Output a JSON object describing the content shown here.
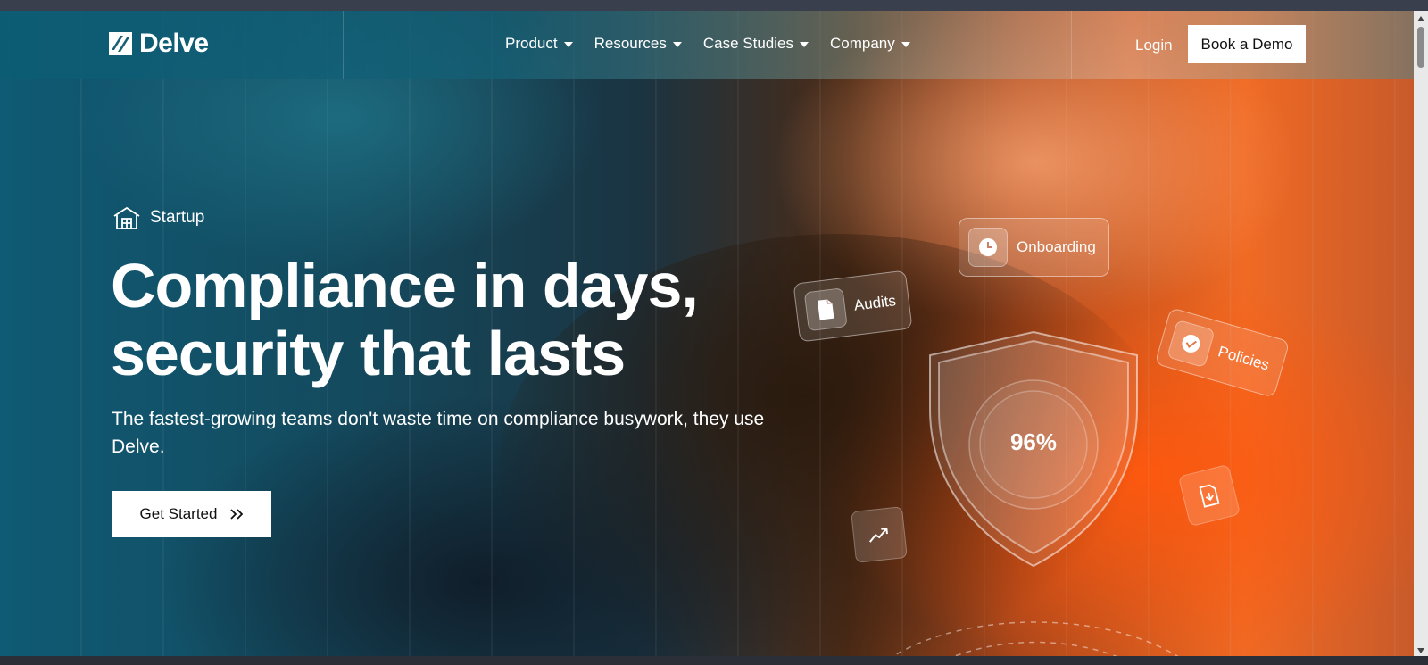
{
  "nav": {
    "brand": "Delve",
    "menu": [
      {
        "label": "Product"
      },
      {
        "label": "Resources"
      },
      {
        "label": "Case Studies"
      },
      {
        "label": "Company"
      }
    ],
    "login": "Login",
    "cta": "Book a Demo"
  },
  "hero": {
    "badge": "Startup",
    "headline_line1": "Compliance in days,",
    "headline_line2": "security that lasts",
    "subheadline": "The fastest-growing teams don't waste time on compliance busywork, they use Delve.",
    "cta": "Get Started"
  },
  "visual": {
    "cards": {
      "audits": "Audits",
      "onboarding": "Onboarding",
      "policies": "Policies"
    },
    "score": "96%"
  },
  "colors": {
    "accent_orange": "#f06a24",
    "teal": "#0f5a74",
    "white": "#ffffff"
  },
  "icons": [
    "brand-logo-icon",
    "chevron-down-icon",
    "building-icon",
    "double-chevron-right-icon",
    "document-icon",
    "clock-icon",
    "check-icon",
    "trend-up-icon",
    "file-download-icon",
    "shield-icon"
  ]
}
